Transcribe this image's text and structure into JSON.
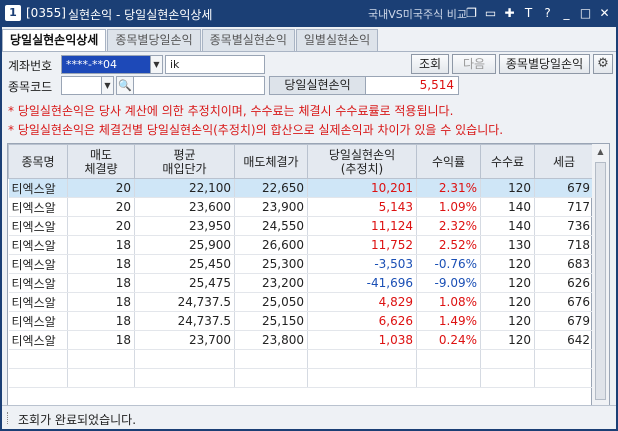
{
  "window": {
    "number": "1",
    "code": "[0355]",
    "title": "실현손익 - 당일실현손익상세",
    "right_label": "국내VS미국주식 비교",
    "icons": [
      "restore-icon",
      "minimize-icon",
      "pin-icon",
      "text-icon",
      "help-icon",
      "minimize-icon",
      "maximize-icon",
      "close-icon"
    ]
  },
  "tabs": [
    {
      "label": "당일실현손익상세",
      "active": true
    },
    {
      "label": "종목별당일손익",
      "active": false
    },
    {
      "label": "종목별실현손익",
      "active": false
    },
    {
      "label": "일별실현손익",
      "active": false
    }
  ],
  "form": {
    "account_label": "계좌번호",
    "account_value": "****-**04",
    "account_name": "ik",
    "stock_code_label": "종목코드",
    "stock_code_value": "",
    "stock_name_value": "",
    "query_button": "조회",
    "next_button": "다음",
    "by_stock_button": "종목별당일손익",
    "pl_label": "당일실현손익",
    "pl_value": "5,514"
  },
  "notes": [
    "* 당일실현손익은 당사 계산에 의한 추정치이며, 수수료는 체결시 수수료률로 적용됩니다.",
    "* 당일실현손익은 체결건별 당일실현손익(추정치)의 합산으로 실제손익과 차이가 있을 수 있습니다."
  ],
  "table": {
    "headers": [
      [
        "종목명",
        ""
      ],
      [
        "매도",
        "체결량"
      ],
      [
        "평균",
        "매입단가"
      ],
      [
        "매도체결가",
        ""
      ],
      [
        "당일실현손익",
        "(추정치)"
      ],
      [
        "수익률",
        ""
      ],
      [
        "수수료",
        ""
      ],
      [
        "세금",
        ""
      ]
    ],
    "rows": [
      {
        "name": "티엑스알",
        "qty": "20",
        "avg": "22,100",
        "sell": "22,650",
        "pl": "10,201",
        "rate": "2.31%",
        "fee": "120",
        "tax": "679",
        "sign": "pos",
        "selected": true
      },
      {
        "name": "티엑스알",
        "qty": "20",
        "avg": "23,600",
        "sell": "23,900",
        "pl": "5,143",
        "rate": "1.09%",
        "fee": "140",
        "tax": "717",
        "sign": "pos",
        "selected": false
      },
      {
        "name": "티엑스알",
        "qty": "20",
        "avg": "23,950",
        "sell": "24,550",
        "pl": "11,124",
        "rate": "2.32%",
        "fee": "140",
        "tax": "736",
        "sign": "pos",
        "selected": false
      },
      {
        "name": "티엑스알",
        "qty": "18",
        "avg": "25,900",
        "sell": "26,600",
        "pl": "11,752",
        "rate": "2.52%",
        "fee": "130",
        "tax": "718",
        "sign": "pos",
        "selected": false
      },
      {
        "name": "티엑스알",
        "qty": "18",
        "avg": "25,450",
        "sell": "25,300",
        "pl": "-3,503",
        "rate": "-0.76%",
        "fee": "120",
        "tax": "683",
        "sign": "neg",
        "selected": false
      },
      {
        "name": "티엑스알",
        "qty": "18",
        "avg": "25,475",
        "sell": "23,200",
        "pl": "-41,696",
        "rate": "-9.09%",
        "fee": "120",
        "tax": "626",
        "sign": "neg",
        "selected": false
      },
      {
        "name": "티엑스알",
        "qty": "18",
        "avg": "24,737.5",
        "sell": "25,050",
        "pl": "4,829",
        "rate": "1.08%",
        "fee": "120",
        "tax": "676",
        "sign": "pos",
        "selected": false
      },
      {
        "name": "티엑스알",
        "qty": "18",
        "avg": "24,737.5",
        "sell": "25,150",
        "pl": "6,626",
        "rate": "1.49%",
        "fee": "120",
        "tax": "679",
        "sign": "pos",
        "selected": false
      },
      {
        "name": "티엑스알",
        "qty": "18",
        "avg": "23,700",
        "sell": "23,800",
        "pl": "1,038",
        "rate": "0.24%",
        "fee": "120",
        "tax": "642",
        "sign": "pos",
        "selected": false
      }
    ]
  },
  "status": {
    "text": "조회가 완료되었습니다."
  },
  "colors": {
    "titlebar": "#1b3f75",
    "positive": "#dd1111",
    "negative": "#1a4fb5",
    "selected_row": "#cfe6f7",
    "note_text": "#d81818"
  }
}
